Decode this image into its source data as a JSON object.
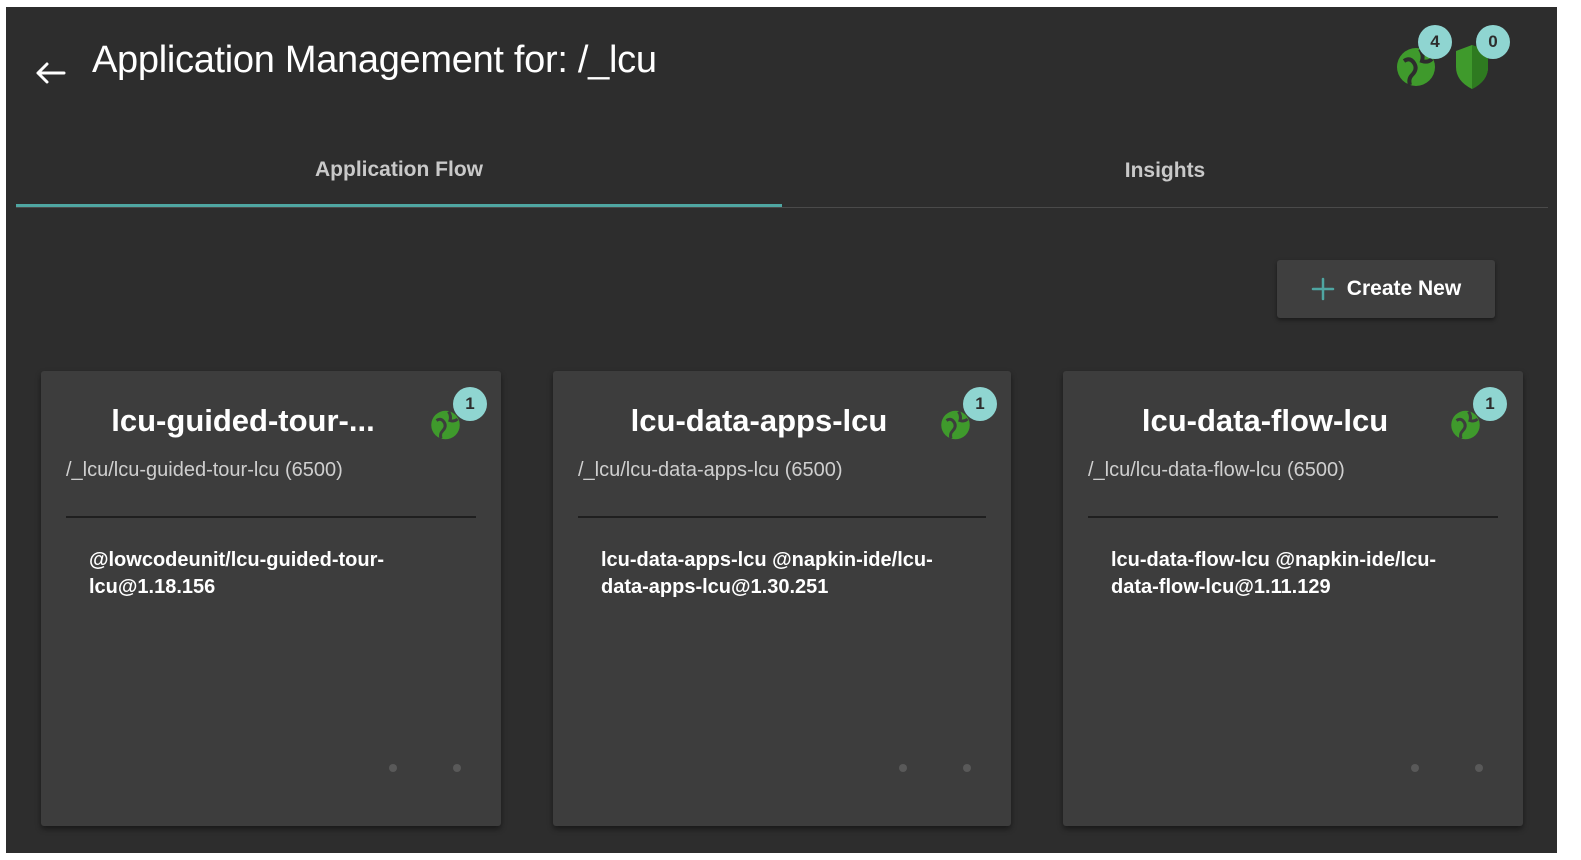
{
  "header": {
    "title": "Application Management for: /_lcu",
    "back_icon": "arrow-left-icon",
    "status": [
      {
        "icon": "globe-icon",
        "count": "4"
      },
      {
        "icon": "shield-icon",
        "count": "0"
      }
    ]
  },
  "tabs": [
    {
      "label": "Application Flow",
      "active": true
    },
    {
      "label": "Insights",
      "active": false
    }
  ],
  "actions": {
    "create_label": "Create New",
    "create_icon": "plus-icon"
  },
  "cards": [
    {
      "title": "lcu-guided-tour-...",
      "subtitle": "/_lcu/lcu-guided-tour-lcu (6500)",
      "body": "@lowcodeunit/lcu-guided-tour-lcu@1.18.156",
      "badge": "1",
      "icon": "globe-icon"
    },
    {
      "title": "lcu-data-apps-lcu",
      "subtitle": "/_lcu/lcu-data-apps-lcu (6500)",
      "body": "lcu-data-apps-lcu @napkin-ide/lcu-data-apps-lcu@1.30.251",
      "badge": "1",
      "icon": "globe-icon"
    },
    {
      "title": "lcu-data-flow-lcu",
      "subtitle": "/_lcu/lcu-data-flow-lcu (6500)",
      "body": "lcu-data-flow-lcu @napkin-ide/lcu-data-flow-lcu@1.11.129",
      "badge": "1",
      "icon": "globe-icon"
    }
  ],
  "colors": {
    "background": "#2d2d2d",
    "card": "#3d3d3d",
    "accent": "#4fa6a2",
    "badge": "#8fd5d1",
    "status_green": "#3f9a2c"
  }
}
